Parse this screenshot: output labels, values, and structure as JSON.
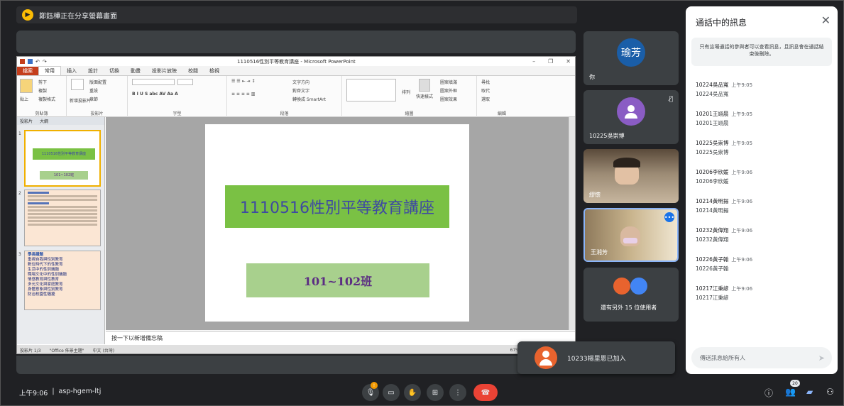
{
  "share_banner": "鄭鈺樺正在分享螢幕畫面",
  "ppt": {
    "window_title": "1110516性別平等教育講座 - Microsoft PowerPoint",
    "tabs": [
      "檔案",
      "常用",
      "插入",
      "設計",
      "切換",
      "動畫",
      "投影片放映",
      "校閱",
      "檢視"
    ],
    "ribbon_groups": [
      "剪貼簿",
      "投影片",
      "字型",
      "段落",
      "繪圖",
      "編輯"
    ],
    "ribbon_items": {
      "paste": "貼上",
      "cut": "剪下",
      "copy": "複製",
      "format_painter": "複製格式",
      "new_slide": "新增投影片",
      "layout": "版面配置",
      "reset": "重設",
      "section": "章節",
      "text_direction": "文字方向",
      "align_text": "對齊文字",
      "smartart": "轉換成 SmartArt",
      "arrange": "排列",
      "quick_styles": "快速樣式",
      "shape_fill": "圖案填滿",
      "shape_outline": "圖案外框",
      "shape_effects": "圖案效果",
      "find": "尋找",
      "replace": "取代",
      "select": "選取"
    },
    "pane_tabs": [
      "投影片",
      "大綱"
    ],
    "slide_numbers": [
      "1",
      "2",
      "3"
    ],
    "thumb1_title": "1110516性別平等教育講座",
    "thumb1_sub": "101~102班",
    "thumb3_lines": [
      "學長講題",
      "重視自我與性別教育",
      "數位時代下的性教育",
      "生活中的性別議題",
      "職場文化中的性別議題",
      "情感教育與性教育",
      "多元文化與家庭教育",
      "身體意象與性別教育",
      "防治校園性騷擾"
    ],
    "slide_title": "1110516性別平等教育講座",
    "slide_subtitle": "101~102班",
    "notes_placeholder": "按一下以新增備忘稿",
    "status_slide": "投影片 1/3",
    "status_theme": "\"Office 佈景主題\"",
    "status_lang": "中文 (台灣)",
    "zoom": "67%"
  },
  "tiles": {
    "presenter_initials": "瑜芳",
    "self_label": "你",
    "participant2_name": "10225吳崇博",
    "video3_name": "繆懷",
    "video4_name": "王湘芳",
    "others_label": "還有另外 15 位使用者"
  },
  "notification": "10233楊里恩已加入",
  "chat": {
    "title": "通話中的訊息",
    "note": "只有這場通話的參與者可以查看訊息，且訊息會在通話結束後刪除。",
    "messages": [
      {
        "who": "10224吳品寬",
        "time": "上午9:05",
        "text": "10224吳品寬"
      },
      {
        "who": "10201王翊晨",
        "time": "上午9:05",
        "text": "10201王翊晨"
      },
      {
        "who": "10225吳崇博",
        "time": "上午9:05",
        "text": "10225吳崇博"
      },
      {
        "who": "10206李欣媛",
        "time": "上午9:06",
        "text": "10206李欣媛"
      },
      {
        "who": "10214黃明揚",
        "time": "上午9:06",
        "text": "10214黃明揚"
      },
      {
        "who": "10232黃偉翔",
        "time": "上午9:06",
        "text": "10232黃偉翔"
      },
      {
        "who": "10226黃子翰",
        "time": "上午9:06",
        "text": "10226黃子翰"
      },
      {
        "who": "10217江秉諺",
        "time": "上午9:06",
        "text": "10217江秉諺"
      }
    ],
    "input_placeholder": "傳送訊息給所有人"
  },
  "bottom": {
    "time": "上午9:06",
    "meeting_code": "asp-hgem-ltj",
    "people_count": "20",
    "mic_badge": "!"
  },
  "colors": {
    "slide_title_bg": "#7ac144",
    "slide_sub_bg": "#a8d08d",
    "end_call": "#ea4335",
    "presenter_avatar": "#1a5ea8",
    "participant_avatar": "#8a5cc4"
  }
}
